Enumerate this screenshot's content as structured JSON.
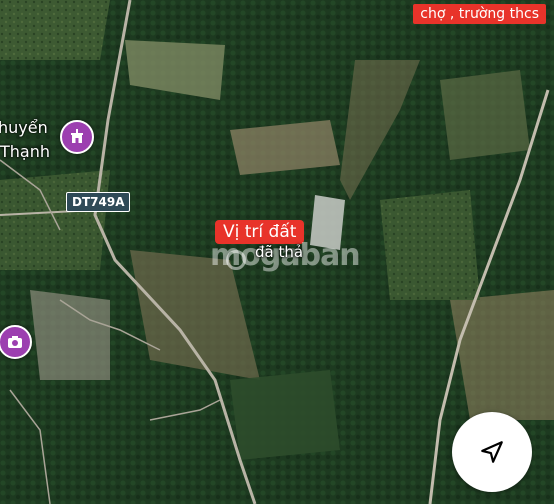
{
  "labels": {
    "top_label": "chợ , trường thcs",
    "site_label": "Vị trí đất",
    "place_line1": "huyển",
    "place_line2": "Thạnh",
    "stone_label": "đã thả",
    "road_label": "DT749A",
    "watermark": "mogaban"
  },
  "icons": {
    "temple_poi": "temple-icon",
    "camera_poi": "camera-icon",
    "navigation": "navigation-arrow-icon"
  },
  "colors": {
    "label_red": "#e8332a",
    "poi_purple": "#9c3fb0",
    "road_badge": "#2f4a57"
  }
}
